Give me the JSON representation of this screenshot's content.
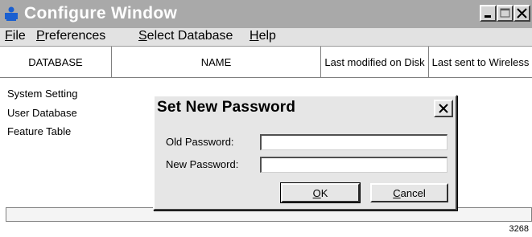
{
  "window": {
    "title": "Configure Window",
    "colors": {
      "titlebar": "#a9a9a9",
      "title_text": "#ffffff",
      "icon": "#1a5fd0"
    },
    "icon": "person-icon",
    "controls": [
      "minimize-icon",
      "maximize-icon",
      "close-icon"
    ]
  },
  "menu": [
    {
      "key": "F",
      "rest": "ile"
    },
    {
      "key": "P",
      "rest": "references"
    },
    {
      "key": "S",
      "rest": "elect Database"
    },
    {
      "key": "H",
      "rest": "elp"
    }
  ],
  "table": {
    "columns": [
      "DATABASE",
      "NAME",
      "Last modified on Disk",
      "Last sent to Wireless"
    ],
    "rows": [
      "System Setting",
      "User Database",
      "Feature Table"
    ]
  },
  "dialog": {
    "title": "Set New Password",
    "old_password_label": "Old Password:",
    "new_password_label": "New Password:",
    "old_password_value": "",
    "new_password_value": "",
    "ok_key": "O",
    "ok_rest": "K",
    "cancel_key": "C",
    "cancel_rest": "ancel"
  },
  "figure_number": "3268"
}
